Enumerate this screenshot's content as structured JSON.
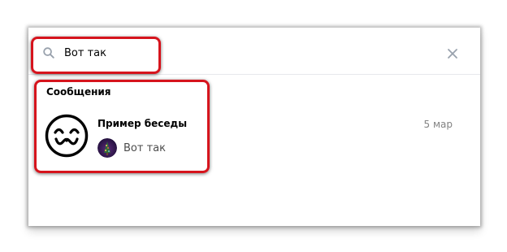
{
  "search": {
    "value": "Вот так",
    "icon": "search-icon",
    "clear_icon": "close-icon"
  },
  "results": {
    "section_title": "Сообщения",
    "conversation": {
      "name": "Пример беседы",
      "date": "5 мар",
      "last_message": "Вот так",
      "avatar_icon": "smiley-face-icon"
    }
  },
  "colors": {
    "highlight": "#d6141d",
    "date_text": "#828282",
    "icon_gray": "#99a2ad"
  }
}
